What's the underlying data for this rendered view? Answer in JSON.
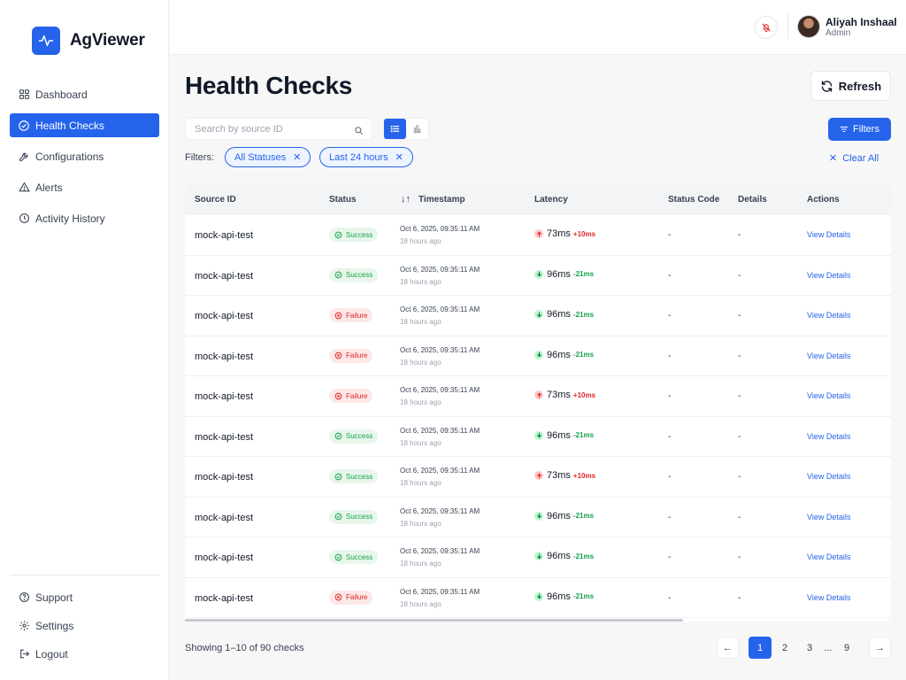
{
  "app": {
    "name": "AgViewer"
  },
  "sidebar": {
    "items": [
      {
        "label": "Dashboard",
        "icon": "grid-icon"
      },
      {
        "label": "Health Checks",
        "icon": "check-circle-icon",
        "active": true
      },
      {
        "label": "Configurations",
        "icon": "wrench-icon"
      },
      {
        "label": "Alerts",
        "icon": "alert-triangle-icon"
      },
      {
        "label": "Activity History",
        "icon": "clock-icon"
      }
    ],
    "bottom": [
      {
        "label": "Support",
        "icon": "help-circle-icon"
      },
      {
        "label": "Settings",
        "icon": "gear-icon"
      },
      {
        "label": "Logout",
        "icon": "logout-icon"
      }
    ]
  },
  "topbar": {
    "user": {
      "name": "Aliyah Inshaal",
      "role": "Admin"
    }
  },
  "page": {
    "title": "Health Checks",
    "refresh_label": "Refresh",
    "search_placeholder": "Search by source ID",
    "filters_button": "Filters",
    "filters_label": "Filters:",
    "chips": [
      "All Statuses",
      "Last 24 hours"
    ],
    "clear_all": "Clear All"
  },
  "table": {
    "columns": [
      "Source ID",
      "Status",
      "Timestamp",
      "Latency",
      "Status Code",
      "Details",
      "Actions"
    ],
    "rows": [
      {
        "source": "mock-api-test",
        "status": "Success",
        "ts": "Oct 6, 2025, 09:35:11 AM",
        "ago": "18 hours ago",
        "latency": "73ms",
        "delta": "+10ms",
        "dir": "up",
        "code": "-",
        "details": "-",
        "action": "View Details"
      },
      {
        "source": "mock-api-test",
        "status": "Success",
        "ts": "Oct 6, 2025, 09:35:11 AM",
        "ago": "18 hours ago",
        "latency": "96ms",
        "delta": "-21ms",
        "dir": "down",
        "code": "-",
        "details": "-",
        "action": "View Details"
      },
      {
        "source": "mock-api-test",
        "status": "Failure",
        "ts": "Oct 6, 2025, 09:35:11 AM",
        "ago": "18 hours ago",
        "latency": "96ms",
        "delta": "-21ms",
        "dir": "down",
        "code": "-",
        "details": "-",
        "action": "View Details"
      },
      {
        "source": "mock-api-test",
        "status": "Failure",
        "ts": "Oct 6, 2025, 09:35:11 AM",
        "ago": "18 hours ago",
        "latency": "96ms",
        "delta": "-21ms",
        "dir": "down",
        "code": "-",
        "details": "-",
        "action": "View Details"
      },
      {
        "source": "mock-api-test",
        "status": "Failure",
        "ts": "Oct 6, 2025, 09:35:11 AM",
        "ago": "18 hours ago",
        "latency": "73ms",
        "delta": "+10ms",
        "dir": "up",
        "code": "-",
        "details": "-",
        "action": "View Details"
      },
      {
        "source": "mock-api-test",
        "status": "Success",
        "ts": "Oct 6, 2025, 09:35:11 AM",
        "ago": "18 hours ago",
        "latency": "96ms",
        "delta": "-21ms",
        "dir": "down",
        "code": "-",
        "details": "-",
        "action": "View Details"
      },
      {
        "source": "mock-api-test",
        "status": "Success",
        "ts": "Oct 6, 2025, 09:35:11 AM",
        "ago": "18 hours ago",
        "latency": "73ms",
        "delta": "+10ms",
        "dir": "up",
        "code": "-",
        "details": "-",
        "action": "View Details"
      },
      {
        "source": "mock-api-test",
        "status": "Success",
        "ts": "Oct 6, 2025, 09:35:11 AM",
        "ago": "18 hours ago",
        "latency": "96ms",
        "delta": "-21ms",
        "dir": "down",
        "code": "-",
        "details": "-",
        "action": "View Details"
      },
      {
        "source": "mock-api-test",
        "status": "Success",
        "ts": "Oct 6, 2025, 09:35:11 AM",
        "ago": "18 hours ago",
        "latency": "96ms",
        "delta": "-21ms",
        "dir": "down",
        "code": "-",
        "details": "-",
        "action": "View Details"
      },
      {
        "source": "mock-api-test",
        "status": "Failure",
        "ts": "Oct 6, 2025, 09:35:11 AM",
        "ago": "18 hours ago",
        "latency": "96ms",
        "delta": "-21ms",
        "dir": "down",
        "code": "-",
        "details": "-",
        "action": "View Details"
      }
    ]
  },
  "pagination": {
    "showing": "Showing 1–10 of 90 checks",
    "prev": "←",
    "next": "→",
    "pages": [
      "1",
      "2",
      "3"
    ],
    "ellipsis": "...",
    "last": "9",
    "current": "1"
  },
  "colors": {
    "accent": "#2563eb",
    "success": "#16a34a",
    "failure": "#dc2626"
  }
}
